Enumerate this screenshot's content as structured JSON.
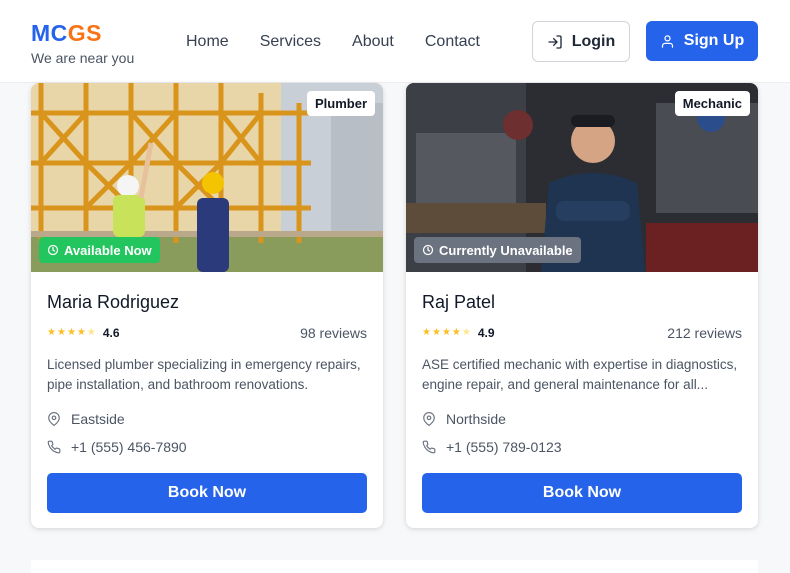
{
  "brand": {
    "logo_a": "MC",
    "logo_b": "GS",
    "tagline": "We are near you"
  },
  "nav": {
    "items": [
      "Home",
      "Services",
      "About",
      "Contact"
    ]
  },
  "actions": {
    "login": "Login",
    "signup": "Sign Up"
  },
  "colors": {
    "primary": "#2563eb",
    "brand_orange": "#f97316",
    "available": "#22c55e",
    "unavailable": "#6b7280",
    "star": "#fbbf24"
  },
  "providers": [
    {
      "category": "Plumber",
      "availability": "Available Now",
      "available": true,
      "name": "Maria Rodriguez",
      "rating": "4.6",
      "rating_stars": 4.6,
      "reviews": "98 reviews",
      "description": "Licensed plumber specializing in emergency repairs, pipe installation, and bathroom renovations.",
      "location": "Eastside",
      "phone": "+1 (555) 456-7890",
      "book_label": "Book Now"
    },
    {
      "category": "Mechanic",
      "availability": "Currently Unavailable",
      "available": false,
      "name": "Raj Patel",
      "rating": "4.9",
      "rating_stars": 4.9,
      "reviews": "212 reviews",
      "description": "ASE certified mechanic with expertise in diagnostics, engine repair, and general maintenance for all...",
      "location": "Northside",
      "phone": "+1 (555) 789-0123",
      "book_label": "Book Now"
    }
  ]
}
